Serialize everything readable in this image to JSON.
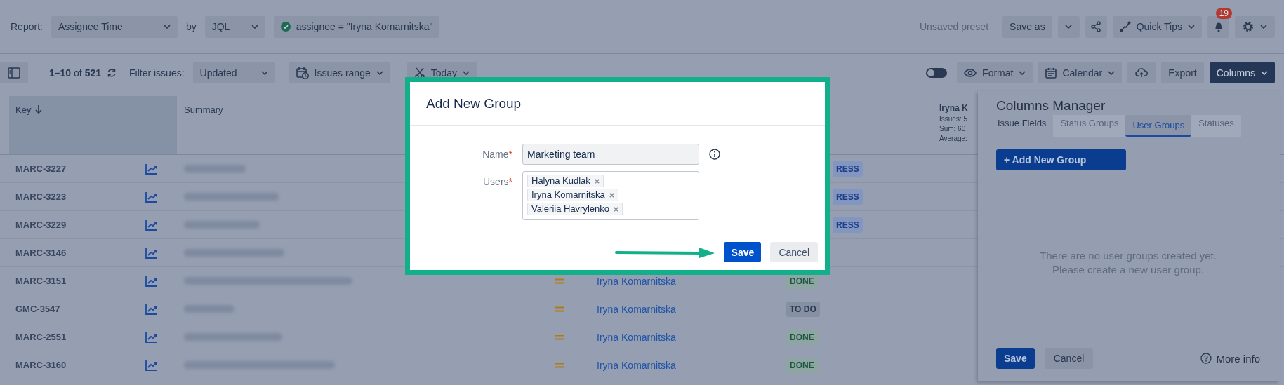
{
  "report_bar": {
    "report_label": "Report:",
    "report": "Assignee Time",
    "by_label": "by",
    "by": "JQL",
    "query": "assignee = \"Iryna Komarnitska\""
  },
  "actions": {
    "preset_status": "Unsaved preset",
    "save_as": "Save as",
    "quick_tips": "Quick Tips",
    "notifications": "19"
  },
  "issues_bar": {
    "count": "**1–10** of **521**",
    "filter_label": "Filter issues:",
    "filter": "Updated",
    "range": "Issues range",
    "date": "Today",
    "toggle": {
      "on": false
    },
    "format": "Format",
    "calendar": "Calendar",
    "export": "Export",
    "columns": "Columns"
  },
  "table": {
    "columns": [
      {
        "label": "Key",
        "sorted": true
      },
      {
        "label": "Summary",
        "sorted": false
      }
    ],
    "user_column": {
      "name": "Iryna K",
      "stats": [
        "Issues: 5",
        "Sum: 60",
        "Average:"
      ]
    },
    "rows": [
      {
        "key": "MARC-3227",
        "status": {
          "label": "RESS",
          "kind": "progress",
          "partly_hidden": true
        }
      },
      {
        "key": "MARC-3223",
        "status": {
          "label": "RESS",
          "kind": "progress",
          "partly_hidden": true
        }
      },
      {
        "key": "MARC-3229",
        "status": {
          "label": "RESS",
          "kind": "progress",
          "partly_hidden": true
        }
      },
      {
        "key": "MARC-3146"
      },
      {
        "key": "MARC-3151",
        "priority_marker": true,
        "assignee": "Iryna Komarnitska",
        "status": {
          "label": "DONE",
          "kind": "done"
        }
      },
      {
        "key": "GMC-3547",
        "priority_marker": true,
        "assignee": "Iryna Komarnitska",
        "status": {
          "label": "TO DO",
          "kind": "todo"
        }
      },
      {
        "key": "MARC-2551",
        "priority_marker": true,
        "assignee": "Iryna Komarnitska",
        "status": {
          "label": "DONE",
          "kind": "done"
        }
      },
      {
        "key": "MARC-3160",
        "priority_marker": true,
        "assignee": "Iryna Komarnitska",
        "status": {
          "label": "DONE",
          "kind": "done"
        }
      }
    ]
  },
  "dialog": {
    "title": "Add New Group",
    "fields": [
      {
        "kind": "text",
        "label": "Name",
        "required_mark": "*",
        "value": "Marketing team"
      },
      {
        "kind": "tags",
        "label": "Users",
        "required_mark": "*",
        "tags": [
          "Halyna Kudlak",
          "Iryna Komarnitska",
          "Valeriia Havrylenko"
        ]
      }
    ],
    "save": "Save",
    "cancel": "Cancel"
  },
  "columns_manager": {
    "title": "Columns Manager",
    "tabs": [
      {
        "label": "Issue Fields",
        "selected": false,
        "disabled": false
      },
      {
        "label": "Status Groups",
        "selected": false,
        "disabled": true
      },
      {
        "label": "User Groups",
        "selected": true,
        "disabled": false
      },
      {
        "label": "Statuses",
        "selected": false,
        "disabled": true
      }
    ],
    "add_button": "+ Add New Group",
    "empty_message": [
      "There are no user groups created yet.",
      "Please create a new user group."
    ],
    "save": "Save",
    "cancel": "Cancel",
    "more_info": "More info"
  }
}
